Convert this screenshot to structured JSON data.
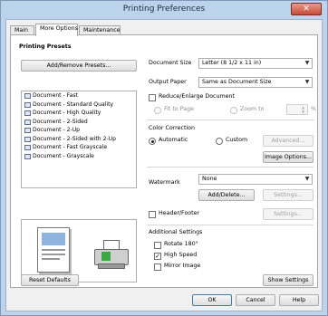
{
  "window": {
    "title": "Printing Preferences",
    "close_label": "✕"
  },
  "tabs": [
    {
      "label": "Main"
    },
    {
      "label": "More Options"
    },
    {
      "label": "Maintenance"
    }
  ],
  "presets": {
    "heading": "Printing Presets",
    "add_remove_label": "Add/Remove Presets...",
    "items": [
      "Document - Fast",
      "Document - Standard Quality",
      "Document - High Quality",
      "Document - 2-Sided",
      "Document - 2-Up",
      "Document - 2-Sided with 2-Up",
      "Document - Fast Grayscale",
      "Document - Grayscale"
    ]
  },
  "document_size": {
    "label": "Document Size",
    "value": "Letter (8 1/2 x 11 in)"
  },
  "output_paper": {
    "label": "Output Paper",
    "value": "Same as Document Size"
  },
  "reduce_enlarge": {
    "label": "Reduce/Enlarge Document",
    "fit_to_page_label": "Fit to Page",
    "zoom_to_label": "Zoom to",
    "percent_label": "%"
  },
  "color_correction": {
    "label": "Color Correction",
    "automatic_label": "Automatic",
    "custom_label": "Custom",
    "advanced_label": "Advanced...",
    "image_options_label": "Image Options..."
  },
  "watermark": {
    "label": "Watermark",
    "value": "None",
    "add_delete_label": "Add/Delete...",
    "settings_label": "Settings..."
  },
  "header_footer": {
    "label": "Header/Footer",
    "settings_label": "Settings..."
  },
  "additional": {
    "label": "Additional Settings",
    "rotate_label": "Rotate 180°",
    "high_speed_label": "High Speed",
    "mirror_label": "Mirror Image"
  },
  "footer": {
    "reset_label": "Reset Defaults",
    "show_settings_label": "Show Settings",
    "ok_label": "OK",
    "cancel_label": "Cancel",
    "help_label": "Help"
  },
  "check_mark": "✓"
}
